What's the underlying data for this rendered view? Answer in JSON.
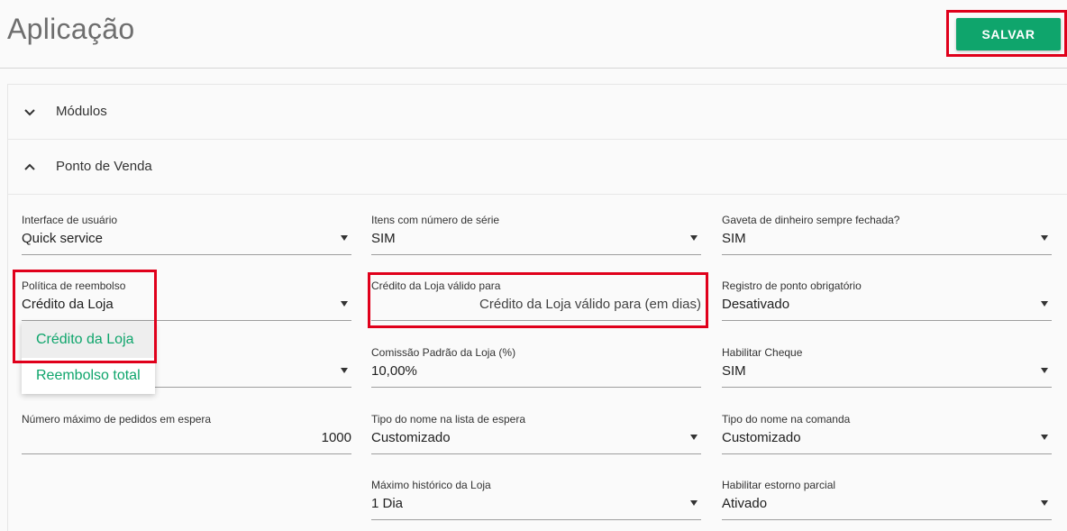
{
  "header": {
    "title": "Aplicação",
    "save_label": "SALVAR"
  },
  "colors": {
    "accent": "#0fa56c",
    "highlight": "#e0001b"
  },
  "accordion": {
    "modulos": {
      "label": "Módulos",
      "icon": "chevron-down-icon",
      "expanded": false
    },
    "ponto_de_venda": {
      "label": "Ponto de Venda",
      "icon": "chevron-up-icon",
      "expanded": true
    }
  },
  "fields": {
    "interface_usuario": {
      "label": "Interface de usuário",
      "value": "Quick service"
    },
    "itens_numero_serie": {
      "label": "Itens com número de série",
      "value": "SIM"
    },
    "gaveta_dinheiro": {
      "label": "Gaveta de dinheiro sempre fechada?",
      "value": "SIM"
    },
    "politica_reembolso": {
      "label": "Política de reembolso",
      "value": "Crédito da Loja"
    },
    "credito_valido": {
      "label": "Crédito da Loja válido para",
      "placeholder": "Crédito da Loja válido para (em dias)"
    },
    "registro_ponto": {
      "label": "Registro de ponto obrigatório",
      "value": "Desativado"
    },
    "comissao_padrao": {
      "label": "Comissão Padrão da Loja (%)",
      "value": "10,00%"
    },
    "habilitar_cheque": {
      "label": "Habilitar Cheque",
      "value": "SIM"
    },
    "max_pedidos_espera": {
      "label": "Número máximo de pedidos em espera",
      "value": "1000"
    },
    "tipo_nome_espera": {
      "label": "Tipo do nome na lista de espera",
      "value": "Customizado"
    },
    "tipo_nome_comanda": {
      "label": "Tipo do nome na comanda",
      "value": "Customizado"
    },
    "maximo_historico": {
      "label": "Máximo histórico da Loja",
      "value": "1 Dia"
    },
    "estorno_parcial": {
      "label": "Habilitar estorno parcial",
      "value": "Ativado"
    }
  },
  "dropdown": {
    "options": [
      "Crédito da Loja",
      "Reembolso total"
    ]
  }
}
